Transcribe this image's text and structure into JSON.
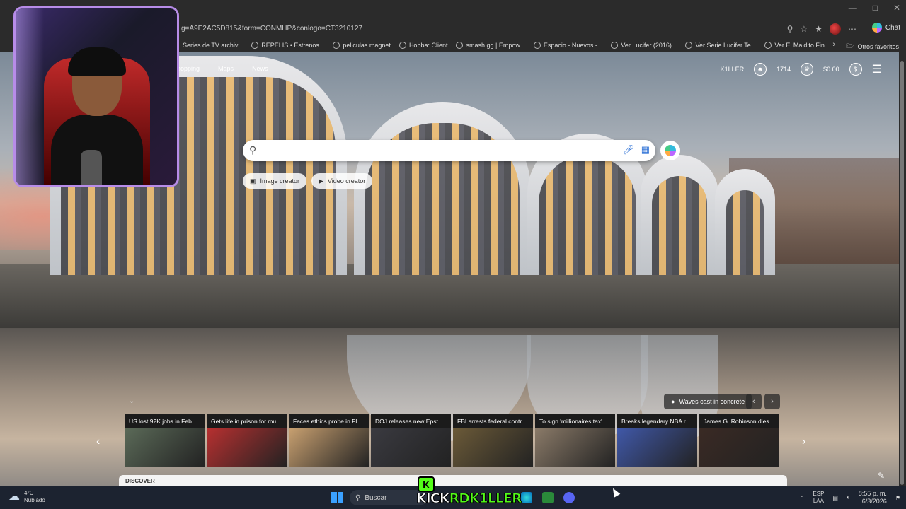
{
  "browser": {
    "url": "g=A9E2AC5D815&form=CONMHP&conlogo=CT3210127",
    "chat_label": "Chat",
    "bookmarks": [
      "Series de TV archiv...",
      "REPELIS • Estrenos...",
      "peliculas magnet",
      "Hobba: Client",
      "smash.gg | Empow...",
      "Espacio - Nuevos -...",
      "Ver Lucifer (2016)...",
      "Ver Serie Lucifer Te...",
      "Ver El Maldito Fin..."
    ],
    "other_favorites": "Otros favoritos"
  },
  "page": {
    "nav": [
      "hopping",
      "Maps",
      "News",
      "···"
    ],
    "user_name": "K1LLER",
    "points": "1714",
    "balance": "$0.00",
    "search_placeholder": "",
    "pills": [
      {
        "icon": "image-creator-icon",
        "label": "Image creator"
      },
      {
        "icon": "video-creator-icon",
        "label": "Video creator"
      }
    ],
    "image_caption": "Waves cast in concrete",
    "news": [
      {
        "headline": "US lost 92K jobs in Feb",
        "color": "#5b6a58"
      },
      {
        "headline": "Gets life in prison for murder",
        "color": "#b73030"
      },
      {
        "headline": "Faces ethics probe in Florida",
        "color": "#c8a070"
      },
      {
        "headline": "DOJ releases new Epstein d...",
        "color": "#3a3a40"
      },
      {
        "headline": "FBI arrests federal contractor",
        "color": "#6b5a38"
      },
      {
        "headline": "To sign 'millionaires tax'",
        "color": "#8a7a68"
      },
      {
        "headline": "Breaks legendary NBA reco...",
        "color": "#4058a8"
      },
      {
        "headline": "James G. Robinson dies",
        "color": "#3a2a24"
      }
    ],
    "discover_label": "DISCOVER"
  },
  "taskbar": {
    "temperature": "4°C",
    "weather_text": "Nublado",
    "search_label": "Buscar",
    "kick_text_white": "KICK",
    "kick_text_green": "RDK1LLER",
    "kick_logo_letter": "K",
    "lang_top": "ESP",
    "lang_bottom": "LAA",
    "time": "8:55 p. m.",
    "date": "6/3/2026"
  },
  "colors": {
    "accent_blue": "#2a6fd6",
    "kick_green": "#53fc18",
    "webcam_border": "#b78ce8"
  }
}
